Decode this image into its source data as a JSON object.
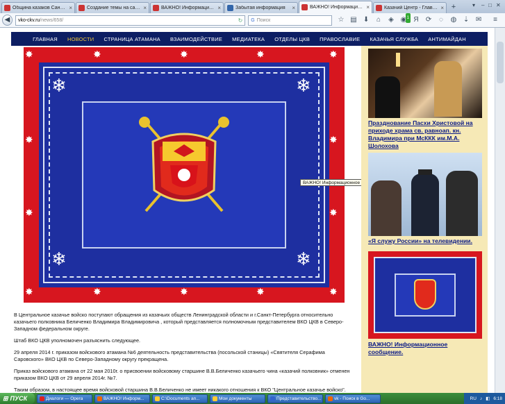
{
  "browser": {
    "tabs": [
      {
        "title": "Община казаков Санкт-...",
        "color": "#c33"
      },
      {
        "title": "Создание темы на сайт...",
        "color": "#c33"
      },
      {
        "title": "ВАЖНО! Информационное с...",
        "color": "#c33"
      },
      {
        "title": "Забытая информация",
        "color": "#36a"
      },
      {
        "title": "ВАЖНО! Информационное с...",
        "color": "#c33",
        "active": true
      },
      {
        "title": "Казачий Центр - Главн...",
        "color": "#c33"
      }
    ],
    "new_tab_label": "+",
    "url_host": "vko-ckv.ru",
    "url_path": "/news/658/",
    "search_placeholder": "Поиск",
    "badge_count": "1"
  },
  "nav": {
    "items": [
      {
        "label": "ГЛАВНАЯ"
      },
      {
        "label": "НОВОСТИ",
        "current": true
      },
      {
        "label": "СТРАНИЦА АТАМАНА"
      },
      {
        "label": "ВЗАИМОДЕЙСТВИЕ"
      },
      {
        "label": "МЕДИАТЕКА"
      },
      {
        "label": "ОТДЕЛЫ ЦКВ"
      },
      {
        "label": "ПРАВОСЛАВИЕ"
      },
      {
        "label": "КАЗАЧЬЯ СЛУЖБА"
      },
      {
        "label": "АНТИМАЙДАН"
      }
    ]
  },
  "tooltip": "ВАЖНО! Информационное сообщение.",
  "article": {
    "paragraphs": [
      "В Центральное казачье войско поступают обращения из казачьих обществ Ленинградской области и г.Санкт-Петербурга относительно казачьего полковника Беличенко Владимира Владимировича , который представляется полномочным представителем ВКО ЦКВ в Северо-Западном федеральном округе.",
      "Штаб ВКО ЦКВ уполномочен разъяснить следующее.",
      "29 апреля 2014 г. приказом войскового атамана №6 деятельность представительства (посольской станицы) «Святителя Серафима Саровского» ВКО ЦКВ по Северо-Западному округу прекращена.",
      "Приказ войскового атамана от 22 мая 2010г. о присвоении войсковому старшине В.В.Беличенко казачьего чина «казачий полковник» отменен приказом ВКО ЦКВ от 29 апреля 2014г. №7.",
      "Таким образом, в настоящее время войсковой старшина В.В.Беличенко не имеет никакого отношения к ВКО \"Центральное казачье войско\"."
    ]
  },
  "sidebar": {
    "items": [
      {
        "caption": "Празднование Пасхи Христовой на приходе храма св. равноап. кн. Владимира при МсККК им.М.А. Шолохова"
      },
      {
        "caption": "«Я служу России» на телевидении."
      },
      {
        "caption": "ВАЖНО! Информационное сообщение."
      }
    ]
  },
  "taskbar": {
    "start_label": "ПУСК",
    "tasks": [
      {
        "label": "Диалоги — Opera",
        "color": "#d22"
      },
      {
        "label": "ВАЖНО! Информ...",
        "color": "#e60"
      },
      {
        "label": "C:\\Documents an...",
        "color": "#fc3"
      },
      {
        "label": "Мои документы",
        "color": "#fc3"
      },
      {
        "label": "Представительство...",
        "color": "#36c"
      },
      {
        "label": "vk - Поиск в Go...",
        "color": "#e60"
      }
    ],
    "lang": "RU",
    "clock": "6:18"
  },
  "colors": {
    "nav_bg": "#0d1e63",
    "flag_red": "#d7161f",
    "flag_blue": "#1e2fa0",
    "sidebar_bg": "#f6e9b6"
  }
}
